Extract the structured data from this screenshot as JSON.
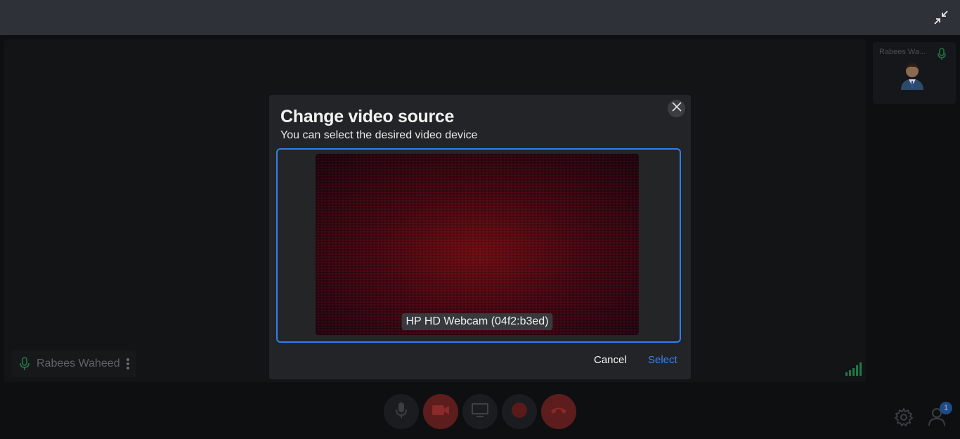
{
  "meeting": {
    "participant_name": "Rabees Waheed",
    "thumbnail_name": "Rabees Wa...",
    "participants_count": "1"
  },
  "modal": {
    "title": "Change video source",
    "subtitle": "You can select the desired video device",
    "device_label": "HP HD Webcam (04f2:b3ed)",
    "cancel_label": "Cancel",
    "select_label": "Select"
  },
  "colors": {
    "accent": "#2f7ef2",
    "select_text": "#3b82f6",
    "danger": "#5e1d1d",
    "success": "#22a05a"
  },
  "icons": {
    "exit_fullscreen": "exit-fullscreen-icon",
    "close": "close-icon",
    "microphone": "microphone-icon",
    "camera_off": "camera-off-icon",
    "screen_share": "screen-share-icon",
    "record": "record-icon",
    "hang_up": "hang-up-icon",
    "settings": "gear-icon",
    "participants": "participants-icon"
  }
}
